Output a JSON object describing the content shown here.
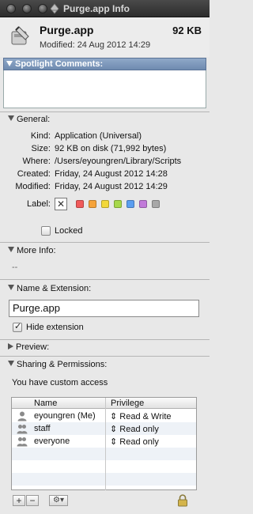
{
  "window": {
    "title": "Purge.app Info"
  },
  "header": {
    "name": "Purge.app",
    "size": "92 KB",
    "modified": "Modified: 24 Aug 2012 14:29"
  },
  "spotlight": {
    "label": "Spotlight Comments:",
    "value": ""
  },
  "general": {
    "label": "General:",
    "rows": [
      {
        "key": "Kind:",
        "value": "Application (Universal)"
      },
      {
        "key": "Size:",
        "value": "92 KB on disk (71,992 bytes)"
      },
      {
        "key": "Where:",
        "value": "/Users/eyoungren/Library/Scripts"
      },
      {
        "key": "Created:",
        "value": "Friday, 24 August 2012 14:28"
      },
      {
        "key": "Modified:",
        "value": "Friday, 24 August 2012 14:29"
      }
    ],
    "label_key": "Label:",
    "label_none": "✕",
    "label_colors": [
      "#f05a5a",
      "#f6a33a",
      "#f2d83a",
      "#a7d84c",
      "#5b9ef0",
      "#c17ad9",
      "#a8a8a8"
    ],
    "locked_label": "Locked",
    "locked": false
  },
  "more_info": {
    "label": "More Info:",
    "value": "--"
  },
  "name_ext": {
    "label": "Name & Extension:",
    "name_value": "Purge.app",
    "hide_ext_label": "Hide extension",
    "hide_ext": true
  },
  "preview": {
    "label": "Preview:"
  },
  "sharing": {
    "label": "Sharing & Permissions:",
    "status": "You have custom access",
    "col_name": "Name",
    "col_priv": "Privilege",
    "rows": [
      {
        "name": "eyoungren (Me)",
        "privilege": "Read & Write",
        "icon": "user-icon"
      },
      {
        "name": "staff",
        "privilege": "Read only",
        "icon": "group-icon"
      },
      {
        "name": "everyone",
        "privilege": "Read only",
        "icon": "group-icon"
      }
    ],
    "add": "+",
    "remove": "−"
  }
}
